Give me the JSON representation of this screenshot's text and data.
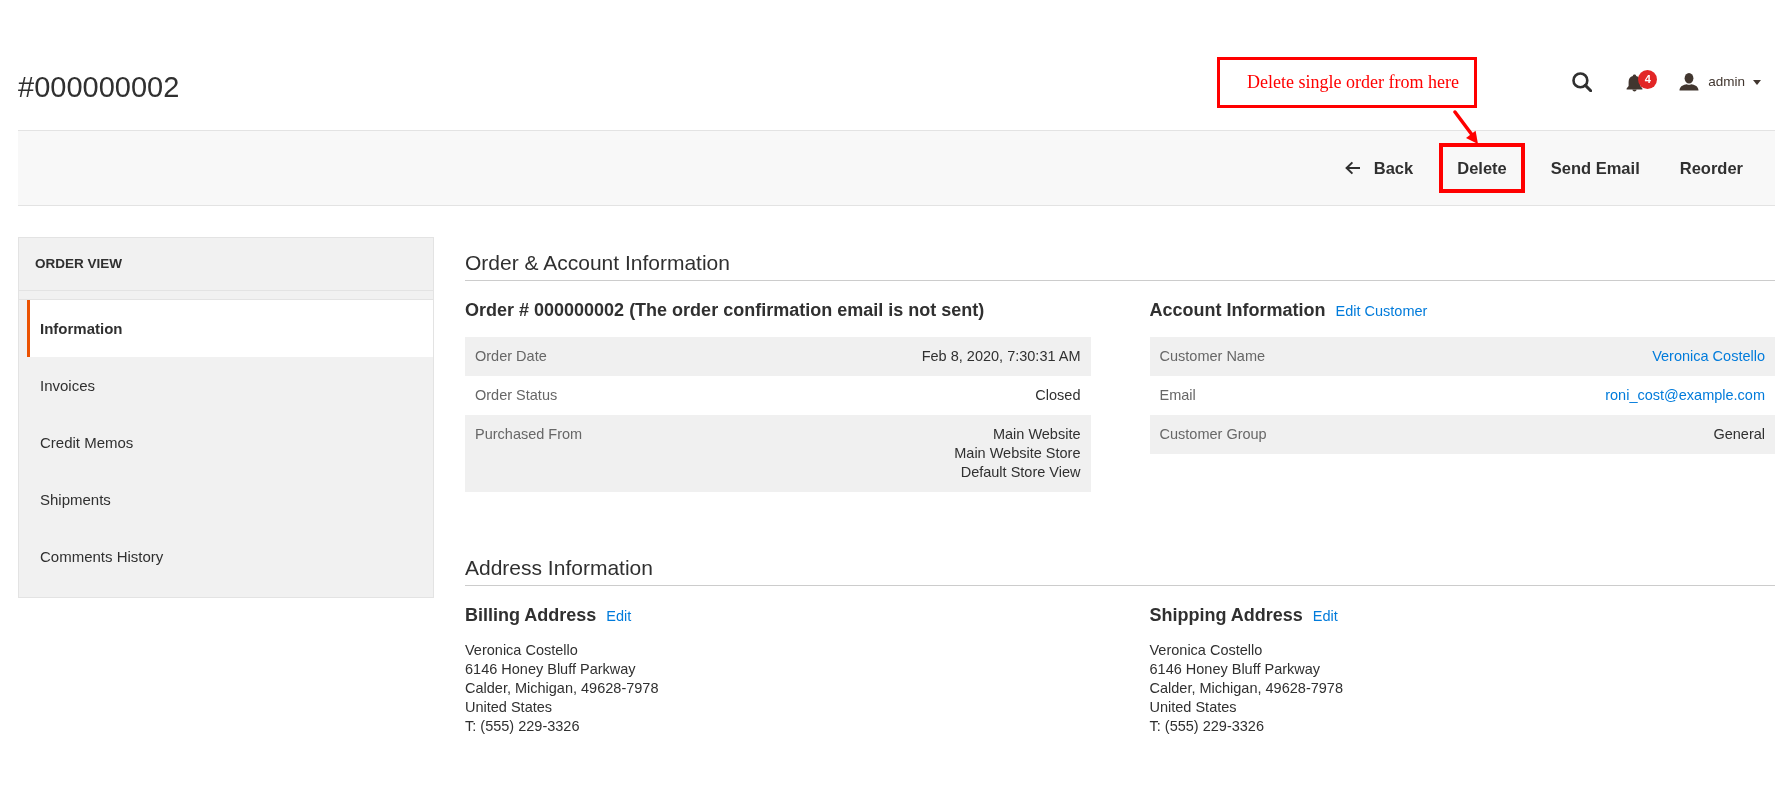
{
  "page_title": "#000000002",
  "header": {
    "notification_count": "4",
    "user_name": "admin"
  },
  "annotation": {
    "text": "Delete single order from here"
  },
  "actions": [
    {
      "kind": "back",
      "label": "Back",
      "highlighted": false
    },
    {
      "kind": "plain",
      "label": "Delete",
      "highlighted": true
    },
    {
      "kind": "plain",
      "label": "Send Email",
      "highlighted": false
    },
    {
      "kind": "plain",
      "label": "Reorder",
      "highlighted": false
    }
  ],
  "sidebar": {
    "title": "ORDER VIEW",
    "items": [
      {
        "label": "Information",
        "selected": true
      },
      {
        "label": "Invoices",
        "selected": false
      },
      {
        "label": "Credit Memos",
        "selected": false
      },
      {
        "label": "Shipments",
        "selected": false
      },
      {
        "label": "Comments History",
        "selected": false
      }
    ]
  },
  "sections": [
    {
      "title": "Order & Account Information",
      "blocks": [
        {
          "kind": "table",
          "heading": "Order # 000000002 (The order confirmation email is not sent)",
          "rows": [
            {
              "label": "Order Date",
              "kind": "text",
              "value": [
                "Feb 8, 2020, 7:30:31 AM"
              ]
            },
            {
              "label": "Order Status",
              "kind": "text",
              "value": [
                "Closed"
              ]
            },
            {
              "label": "Purchased From",
              "kind": "text",
              "value": [
                "Main Website",
                "Main Website Store",
                "Default Store View"
              ]
            }
          ]
        },
        {
          "kind": "table",
          "heading": "Account Information",
          "link": "Edit Customer",
          "rows": [
            {
              "label": "Customer Name",
              "kind": "link",
              "value": [
                "Veronica Costello"
              ]
            },
            {
              "label": "Email",
              "kind": "link",
              "value": [
                "roni_cost@example.com"
              ]
            },
            {
              "label": "Customer Group",
              "kind": "text",
              "value": [
                "General"
              ]
            }
          ]
        }
      ]
    },
    {
      "title": "Address Information",
      "blocks": [
        {
          "kind": "address",
          "heading": "Billing Address",
          "link": "Edit",
          "lines": [
            "Veronica Costello",
            "6146 Honey Bluff Parkway",
            "Calder, Michigan, 49628-7978",
            "United States",
            "T: (555) 229-3326"
          ]
        },
        {
          "kind": "address",
          "heading": "Shipping Address",
          "link": "Edit",
          "lines": [
            "Veronica Costello",
            "6146 Honey Bluff Parkway",
            "Calder, Michigan, 49628-7978",
            "United States",
            "T: (555) 229-3326"
          ]
        }
      ]
    }
  ]
}
